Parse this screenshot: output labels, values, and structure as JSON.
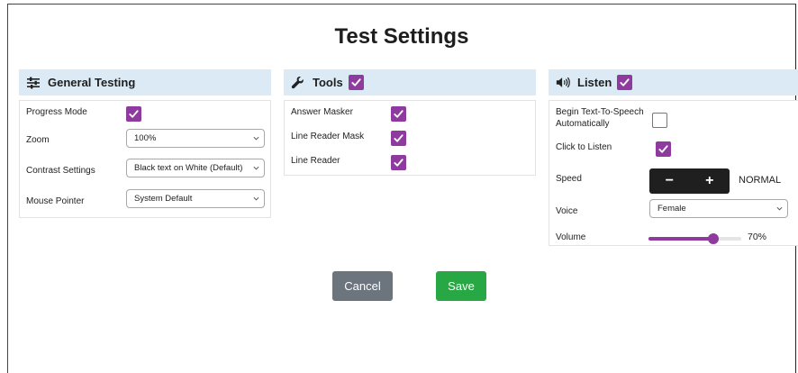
{
  "page": {
    "title": "Test Settings"
  },
  "colors": {
    "accent": "#8e3a9e",
    "header_bg": "#dbeaf4",
    "cancel": "#6c757d",
    "save": "#28a745"
  },
  "general": {
    "header": "General Testing",
    "icon": "sliders-icon",
    "progress_mode": {
      "label": "Progress Mode",
      "checked": true
    },
    "zoom": {
      "label": "Zoom",
      "value": "100%"
    },
    "contrast": {
      "label": "Contrast Settings",
      "value": "Black text on White (Default)"
    },
    "pointer": {
      "label": "Mouse Pointer",
      "value": "System Default"
    }
  },
  "tools": {
    "header": "Tools",
    "icon": "wrench-icon",
    "checked": true,
    "items": [
      {
        "label": "Answer Masker",
        "checked": true
      },
      {
        "label": "Line Reader Mask",
        "checked": true
      },
      {
        "label": "Line Reader",
        "checked": true
      }
    ]
  },
  "listen": {
    "header": "Listen",
    "icon": "speaker-icon",
    "checked": true,
    "auto_tts": {
      "label_line1": "Begin Text-To-Speech",
      "label_line2": "Automatically",
      "checked": false
    },
    "click_to_listen": {
      "label": "Click to Listen",
      "checked": true
    },
    "speed": {
      "label": "Speed",
      "minus": "−",
      "plus": "+",
      "value": "NORMAL"
    },
    "voice": {
      "label": "Voice",
      "value": "Female"
    },
    "volume": {
      "label": "Volume",
      "value_text": "70%",
      "level": 0.7
    }
  },
  "actions": {
    "cancel": "Cancel",
    "save": "Save"
  }
}
